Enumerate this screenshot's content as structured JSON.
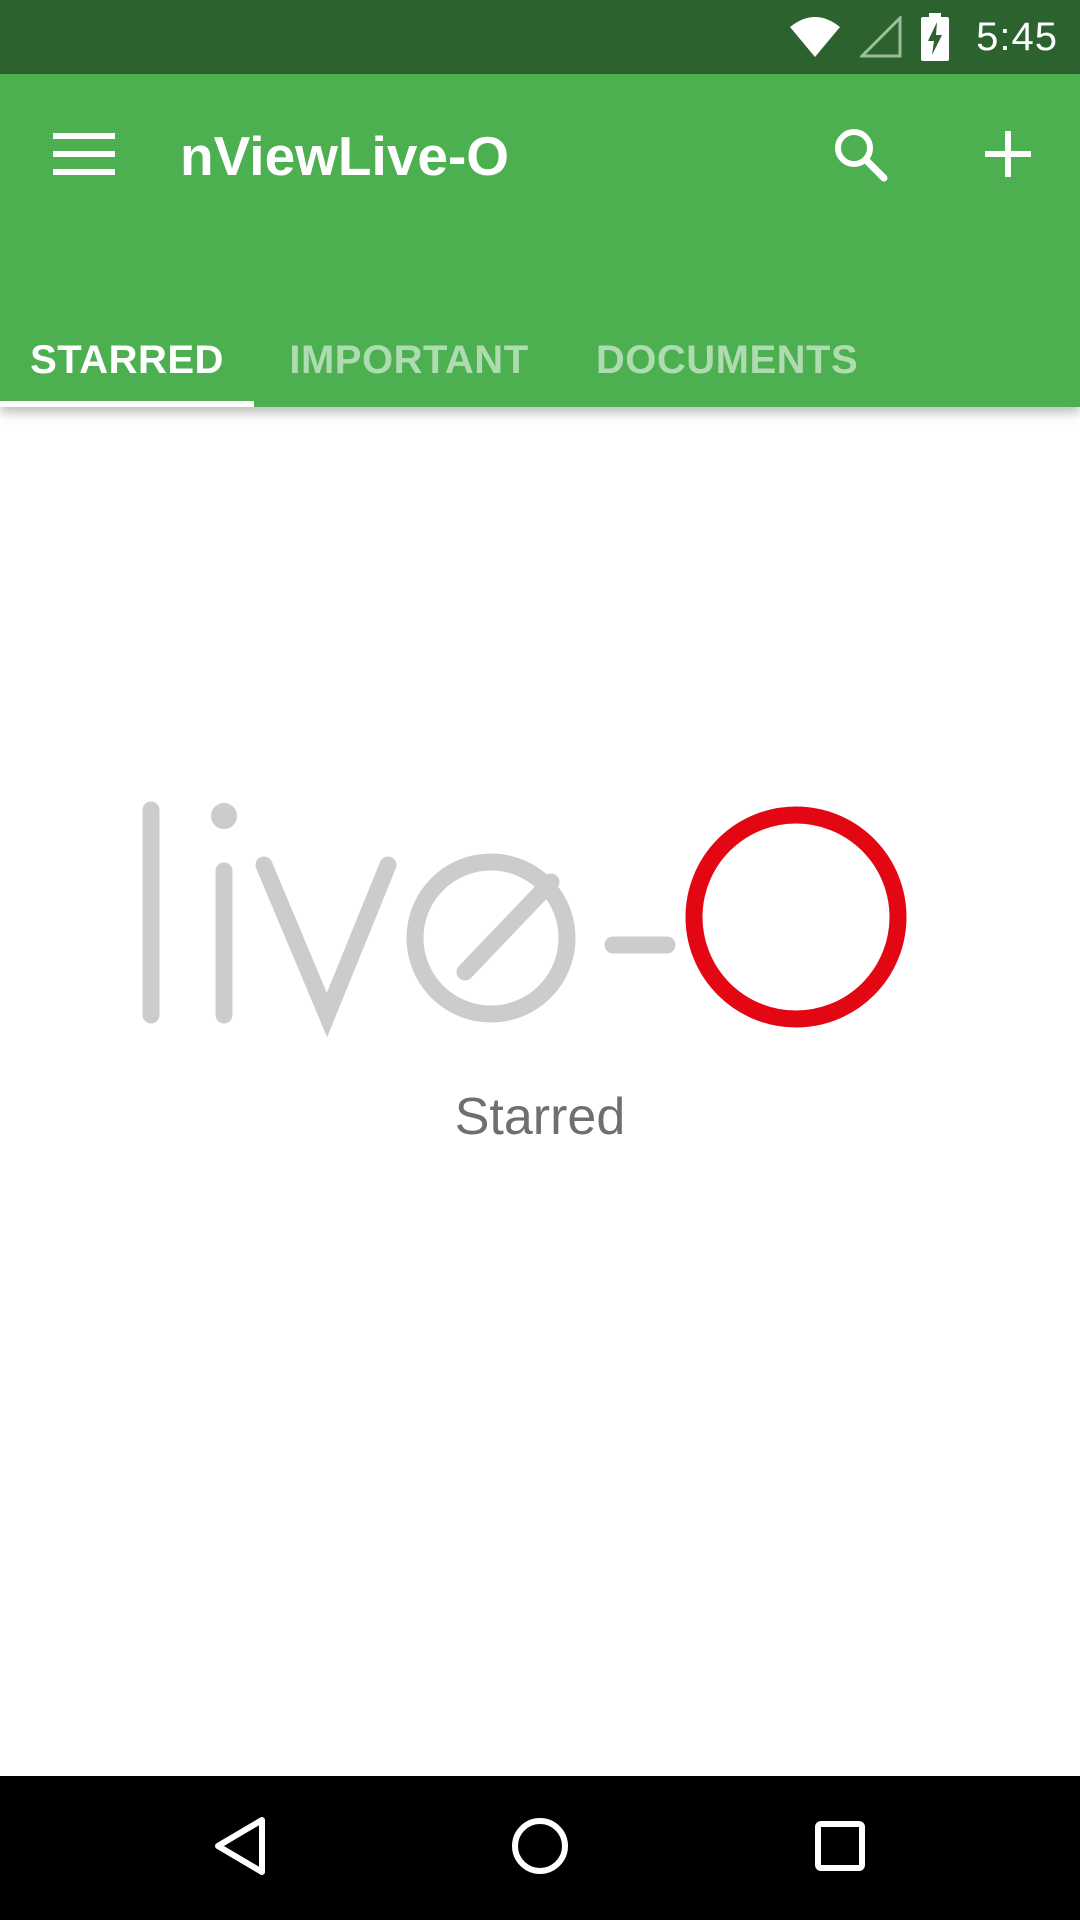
{
  "status_bar": {
    "time": "5:45",
    "icons": [
      "wifi-icon",
      "cell-signal-icon",
      "battery-charging-icon"
    ]
  },
  "app_bar": {
    "title": "nViewLive-O",
    "menu_icon": "hamburger-menu-icon",
    "search_icon": "search-icon",
    "add_icon": "add-icon",
    "background_color": "#4caf50"
  },
  "tabs": [
    {
      "label": "STARRED",
      "active": true
    },
    {
      "label": "IMPORTANT",
      "active": false
    },
    {
      "label": "DOCUMENTS",
      "active": false
    }
  ],
  "main": {
    "logo": "live-O",
    "empty_label": "Starred",
    "logo_colors": {
      "text": "#cccccc",
      "ring": "#e30613"
    }
  },
  "nav_bar": {
    "buttons": [
      "back-icon",
      "home-icon",
      "recents-icon"
    ]
  }
}
